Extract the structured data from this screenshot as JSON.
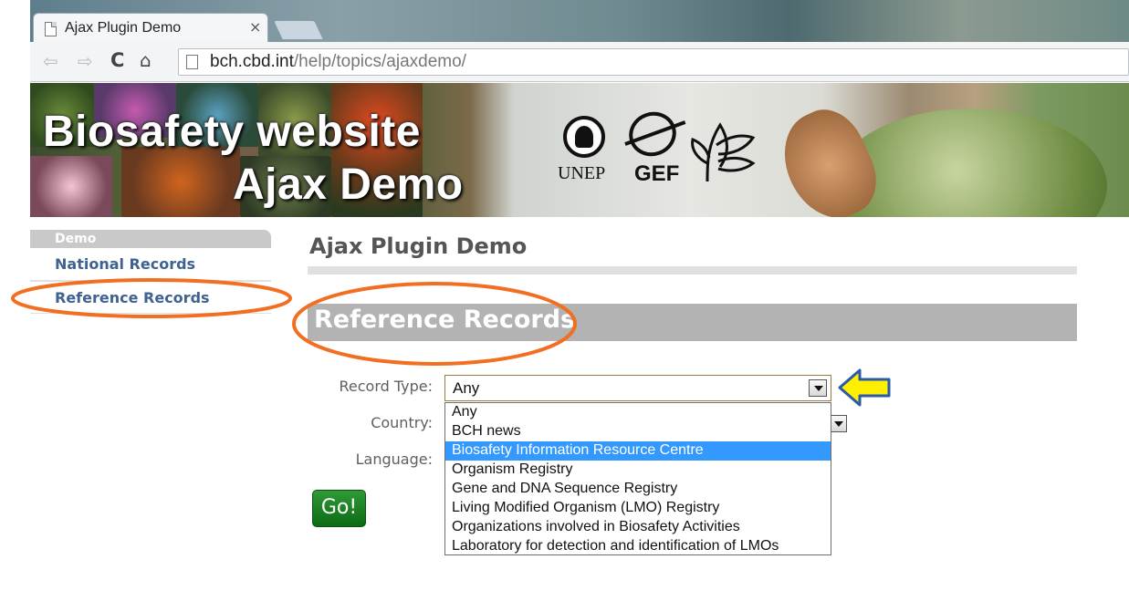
{
  "browser": {
    "tab_title": "Ajax Plugin Demo",
    "tab_close": "×",
    "url_host": "bch.cbd.int",
    "url_path": "/help/topics/ajaxdemo/",
    "icons": [
      "back-arrow-icon",
      "forward-arrow-icon",
      "reload-icon",
      "home-icon",
      "page-icon"
    ]
  },
  "banner": {
    "line1": "Biosafety website",
    "line2": "Ajax Demo",
    "unep_text": "UNEP",
    "gef_text": "GEF"
  },
  "sidebar": {
    "header": "Demo",
    "items": [
      {
        "label": "National Records"
      },
      {
        "label": "Reference Records"
      }
    ]
  },
  "main": {
    "page_title": "Ajax Plugin Demo",
    "section_title": "Reference Records",
    "form": {
      "record_type_label": "Record Type:",
      "country_label": "Country:",
      "language_label": "Language:",
      "record_type_value": "Any",
      "record_type_options": [
        "Any",
        "BCH news",
        "Biosafety Information Resource Centre",
        "Organism Registry",
        "Gene and DNA Sequence Registry",
        "Living Modified Organism (LMO) Registry",
        "Organizations involved in Biosafety Activities",
        "Laboratory for detection and identification of LMOs"
      ],
      "highlighted_option_index": 2,
      "go_label": "Go!"
    }
  },
  "colors": {
    "annotation_orange": "#f26f21",
    "arrow_yellow": "#ffef00",
    "arrow_outline": "#2a5aa8",
    "sidebar_link": "#3f6290",
    "section_bar": "#b3b3b3",
    "go_green": "#1a8a24",
    "dropdown_highlight": "#3399ff"
  }
}
